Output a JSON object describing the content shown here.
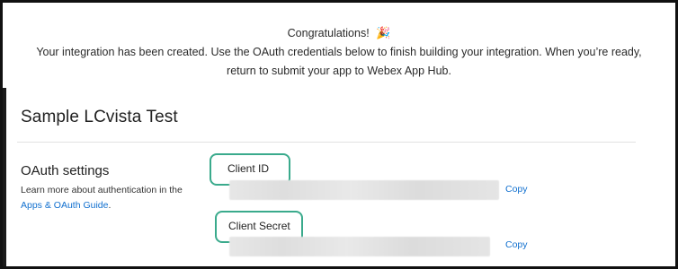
{
  "banner": {
    "heading": "Congratulations!",
    "heading_icon": "party-popper-icon",
    "heading_glyph": "🎉",
    "message_line1": "Your integration has been created. Use the OAuth credentials below to finish building your integration. When you’re ready,",
    "message_line2": "return to submit your app to Webex App Hub."
  },
  "page": {
    "title": "Sample LCvista Test"
  },
  "oauth": {
    "heading": "OAuth settings",
    "desc_text": "Learn more about authentication in the",
    "desc_link": "Apps & OAuth Guide",
    "desc_end": ".",
    "client_id_label": "Client ID",
    "client_secret_label": "Client Secret",
    "copy_label": "Copy"
  },
  "colors": {
    "callout_border": "#3aaa8c",
    "link": "#1170cf"
  }
}
